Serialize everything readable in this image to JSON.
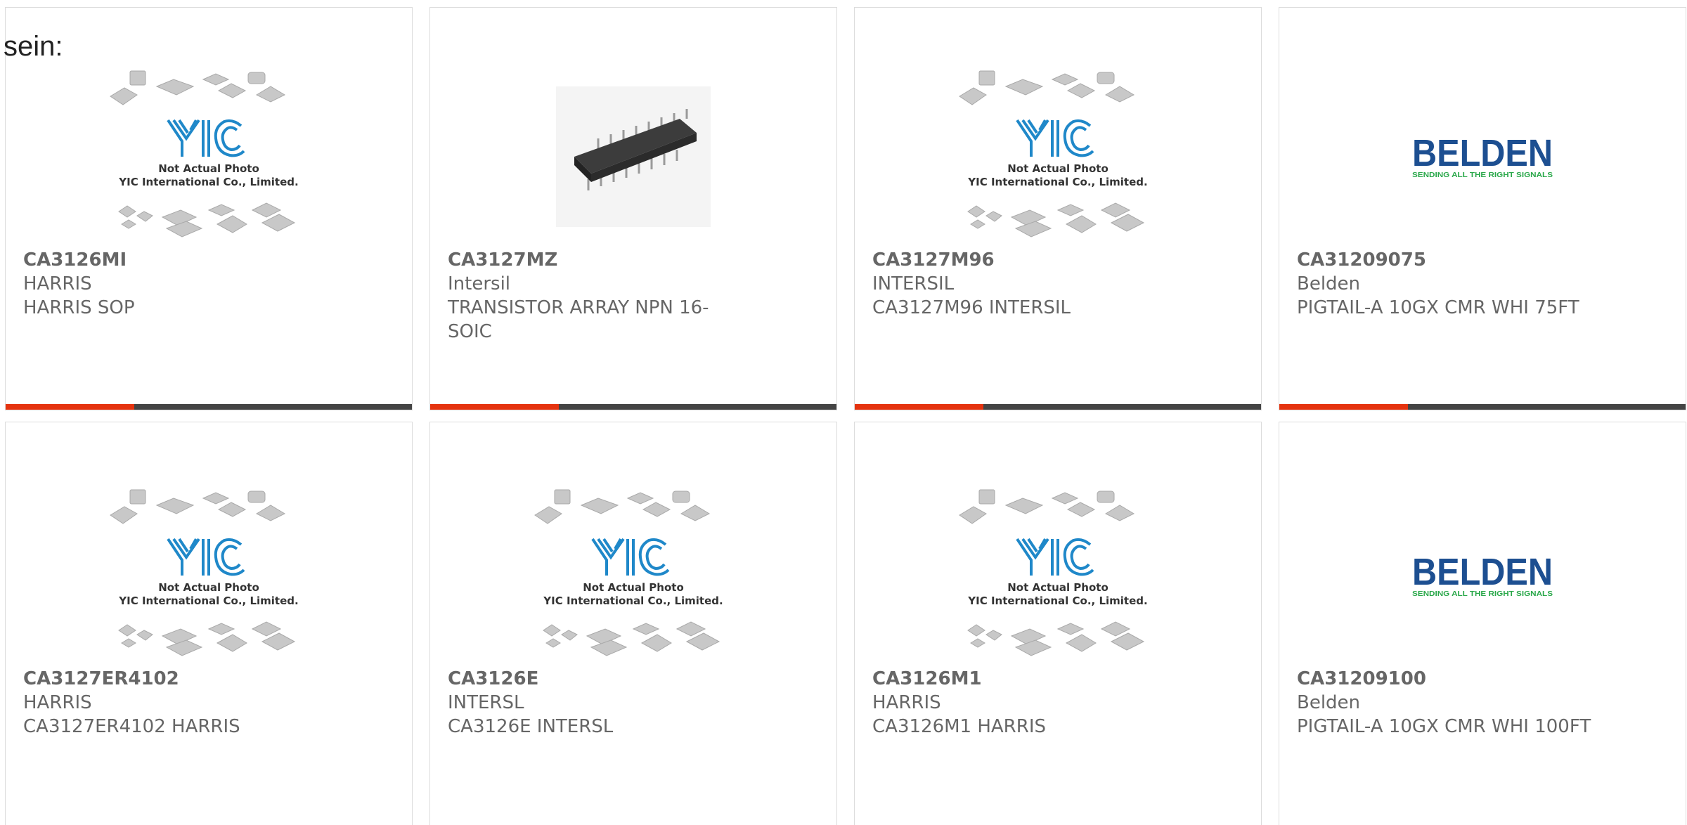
{
  "page": {
    "heading": "sein:"
  },
  "placeholder": {
    "caption_line1": "Not Actual Photo",
    "caption_line2": "YIC International Co., Limited.",
    "logo_text": "YIC"
  },
  "belden": {
    "logo": "BELDEN",
    "tagline": "SENDING ALL THE RIGHT SIGNALS"
  },
  "colors": {
    "accent_red": "#e5330f",
    "bar_dark": "#444444",
    "belden_blue": "#1d4f91",
    "belden_green": "#2aa84a",
    "yic_blue": "#1f88c9"
  },
  "products": [
    {
      "part_number": "CA3126MI",
      "manufacturer": "HARRIS",
      "description": "HARRIS SOP",
      "image": "yic-placeholder"
    },
    {
      "part_number": "CA3127MZ",
      "manufacturer": "Intersil",
      "description": "TRANSISTOR ARRAY NPN 16-SOIC",
      "image": "soic-16-chip"
    },
    {
      "part_number": "CA3127M96",
      "manufacturer": "INTERSIL",
      "description": "CA3127M96 INTERSIL",
      "image": "yic-placeholder"
    },
    {
      "part_number": "CA31209075",
      "manufacturer": "Belden",
      "description": "PIGTAIL-A 10GX CMR WHI 75FT",
      "image": "belden-logo"
    },
    {
      "part_number": "CA3127ER4102",
      "manufacturer": "HARRIS",
      "description": "CA3127ER4102 HARRIS",
      "image": "yic-placeholder"
    },
    {
      "part_number": "CA3126E",
      "manufacturer": "INTERSL",
      "description": "CA3126E INTERSL",
      "image": "yic-placeholder"
    },
    {
      "part_number": "CA3126M1",
      "manufacturer": "HARRIS",
      "description": "CA3126M1 HARRIS",
      "image": "yic-placeholder"
    },
    {
      "part_number": "CA31209100",
      "manufacturer": "Belden",
      "description": "PIGTAIL-A 10GX CMR WHI 100FT",
      "image": "belden-logo"
    }
  ]
}
